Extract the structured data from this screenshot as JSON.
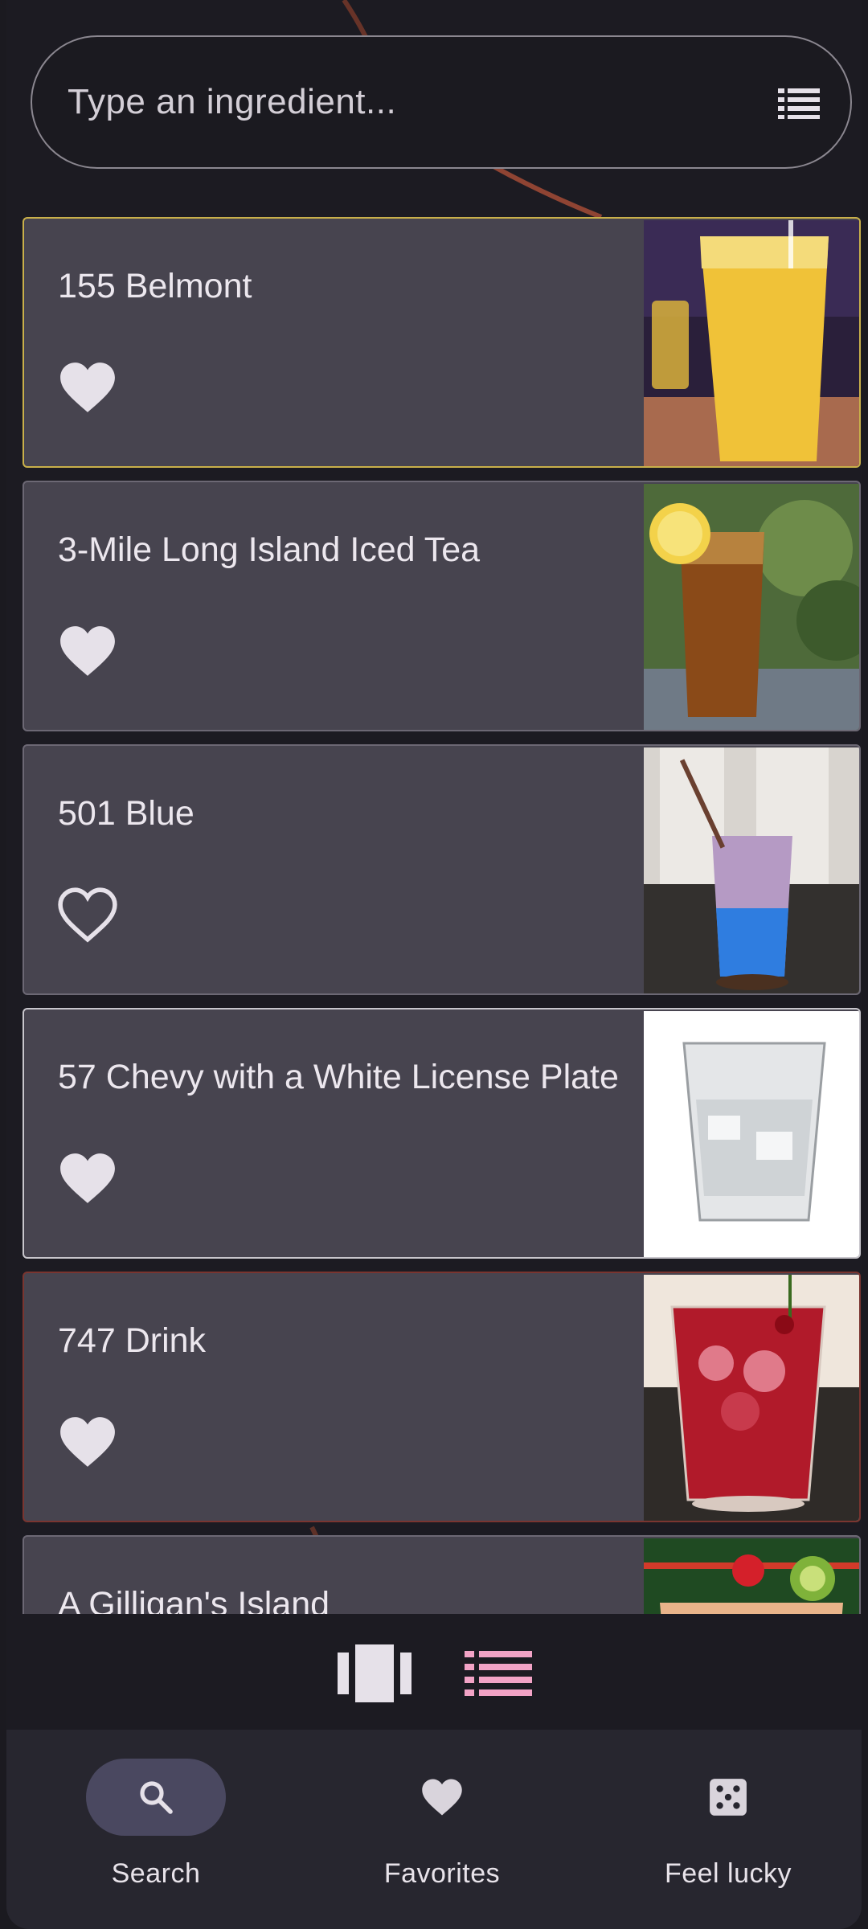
{
  "search": {
    "placeholder": "Type an ingredient..."
  },
  "drinks": [
    {
      "name": "155 Belmont",
      "favorite": true
    },
    {
      "name": "3-Mile Long Island Iced Tea",
      "favorite": true
    },
    {
      "name": "501 Blue",
      "favorite": false
    },
    {
      "name": "57 Chevy with a White License Plate",
      "favorite": true
    },
    {
      "name": "747 Drink",
      "favorite": true
    },
    {
      "name": "A Gilligan's Island",
      "favorite": false
    }
  ],
  "view_toggle": {
    "active": "list"
  },
  "nav": {
    "items": [
      {
        "label": "Search",
        "icon": "search-icon",
        "active": true
      },
      {
        "label": "Favorites",
        "icon": "heart-icon",
        "active": false
      },
      {
        "label": "Feel lucky",
        "icon": "dice-icon",
        "active": false
      }
    ]
  },
  "colors": {
    "accent": "#f2a3c6",
    "card": "#47444f",
    "background": "#1c1b22"
  }
}
